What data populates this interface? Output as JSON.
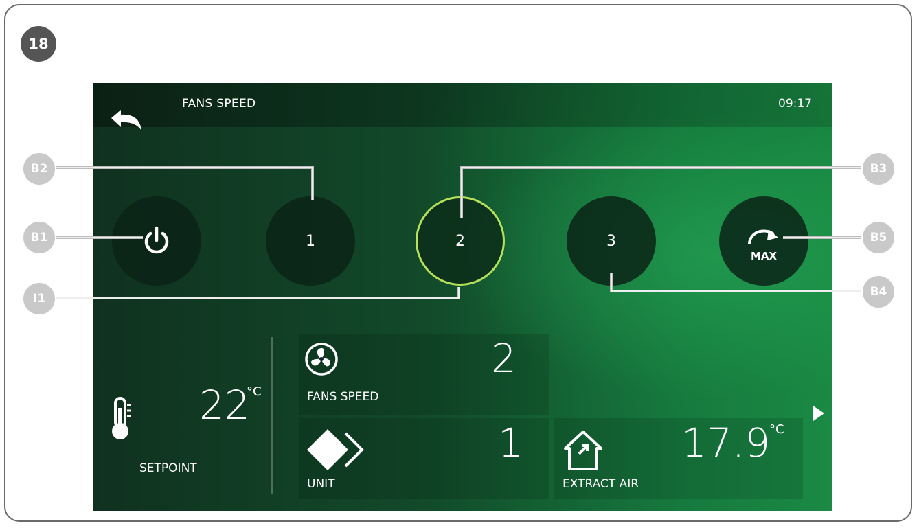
{
  "figure_number": "18",
  "screen": {
    "title": "FANS SPEED",
    "clock": "09:17",
    "speed_buttons": [
      {
        "id": "power",
        "label": ""
      },
      {
        "id": "speed1",
        "label": "1"
      },
      {
        "id": "speed2",
        "label": "2",
        "selected": true
      },
      {
        "id": "speed3",
        "label": "3"
      },
      {
        "id": "max",
        "label": "MAX"
      }
    ],
    "setpoint": {
      "value": "22",
      "unit": "°C",
      "label": "SETPOINT"
    },
    "fans_speed_tile": {
      "value": "2",
      "label": "FANS SPEED"
    },
    "unit_tile": {
      "value": "1",
      "label": "UNIT"
    },
    "extract_air_tile": {
      "value": "17.9",
      "unit": "°C",
      "label": "EXTRACT AIR"
    }
  },
  "callouts": {
    "b1": "B1",
    "b2": "B2",
    "b3": "B3",
    "b4": "B4",
    "b5": "B5",
    "i1": "I1"
  },
  "colors": {
    "selected_ring": "#b7e05a",
    "callout_fill": "#c9c9c9",
    "badge_fill": "#555555"
  },
  "icons": [
    "back-arrow-icon",
    "power-icon",
    "max-arrow-icon",
    "thermometer-icon",
    "fan-icon",
    "unit-icon",
    "house-icon",
    "next-arrow-icon"
  ]
}
